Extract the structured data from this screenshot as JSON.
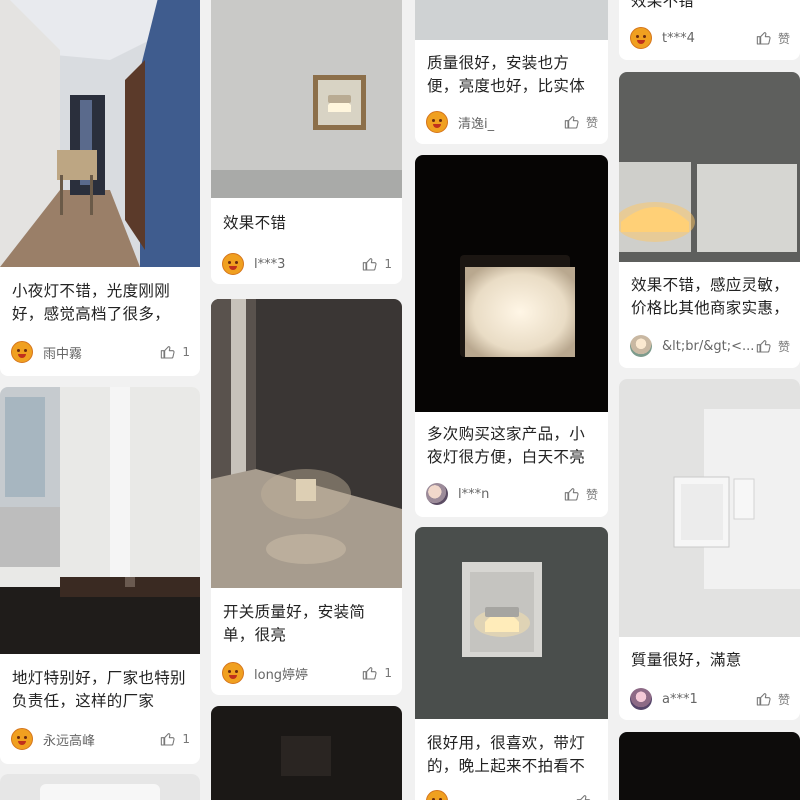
{
  "columns": [
    {
      "cards": [
        {
          "text": "小夜灯不错，光度刚刚好，感觉高档了很多，",
          "user": "雨中霧",
          "likes": "1"
        },
        {
          "text": "地灯特别好，厂家也特别负责任，这样的厂家",
          "user": "永远高峰",
          "likes": "1"
        }
      ]
    },
    {
      "cards": [
        {
          "text": "效果不错",
          "user": "l***3",
          "likes": "1"
        },
        {
          "text": "开关质量好，安装简单，很亮",
          "user": "long婷婷",
          "likes": "1"
        }
      ]
    },
    {
      "cards": [
        {
          "text": "质量很好，安装也方便，亮度也好，比实体",
          "user": "清逸i_",
          "likes": "赞"
        },
        {
          "text": "多次购买这家产品，小夜灯很方便，白天不亮",
          "user": "l***n",
          "likes": "赞"
        },
        {
          "text": "很好用，很喜欢，带灯的，晚上起来不拍看不",
          "user": "",
          "likes": ""
        }
      ]
    },
    {
      "cards": [
        {
          "text": "效果不错",
          "user": "t***4",
          "likes": "赞"
        },
        {
          "text": "效果不错，感应灵敏，价格比其他商家实惠，",
          "user": "&lt;br/&gt;<...",
          "likes": "赞"
        },
        {
          "text": "質量很好，滿意",
          "user": "a***1",
          "likes": "赞"
        }
      ]
    }
  ],
  "icons": {
    "avatar_default": "angry-emoji-avatar-icon",
    "like": "thumbs-up-icon"
  },
  "colors": {
    "background": "#f1f1f1",
    "card": "#ffffff",
    "text": "#222222",
    "meta": "#666666"
  }
}
